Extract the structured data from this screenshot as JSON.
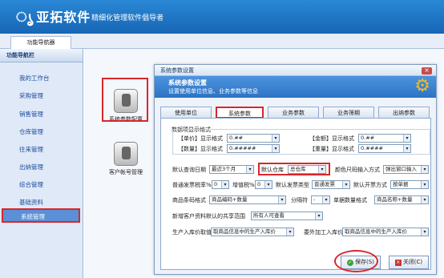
{
  "header": {
    "logo": "亚拓软件",
    "separator": "-",
    "slogan": "精细化管理软件倡导者"
  },
  "tabbar": {
    "tab": "功能导航器"
  },
  "sidebar": {
    "title": "功能导航栏",
    "items": [
      "我的工作台",
      "采购管理",
      "销售管理",
      "仓库管理",
      "往来管理",
      "出纳管理",
      "综合管理",
      "基础资料",
      "系统管理"
    ],
    "active": "系统管理"
  },
  "main": {
    "icons": [
      "系统参数配置",
      "客户帐号管理"
    ]
  },
  "dialog": {
    "title": "系统参数设置",
    "close": "×",
    "banner_title": "系统参数设置",
    "banner_sub": "设置使用单位信息、业务参数等信息",
    "tabs": [
      "使用单位",
      "系统参数",
      "业务参数",
      "业务筛期",
      "出纳参数"
    ],
    "active_tab": "系统参数",
    "group_label": "数据项显示格式",
    "format": {
      "price_label": "【单价】显示格式",
      "price": "0.##",
      "amount_label": "【金额】显示格式",
      "amount": "0.##",
      "qty_label": "【数量】显示格式",
      "qty": "0.#####",
      "weight_label": "【重量】显示格式",
      "weight": "0.####"
    },
    "row1": {
      "query_label": "默认查询日期",
      "query": "最近3个月",
      "wh_label": "默认仓库",
      "wh": "总仓库",
      "color_label": "颜色尺码输入方式",
      "color": "弹出窗口输入"
    },
    "row2": {
      "tax_label": "普通发票税率%",
      "tax": "0",
      "vat_label": "增值税%",
      "vat": "0",
      "invoice_label": "默认发票类型",
      "invoice": "普通发票",
      "open_label": "默认开票方式",
      "open": "按单据"
    },
    "row3": {
      "barcode_label": "商品条码格式",
      "barcode": "商品编码+数量",
      "sep_label": "分隔符",
      "sep": "-",
      "unit_label": "单据数量格式",
      "unit": "商品名称+数量"
    },
    "row4": {
      "share_label": "新增客户资料默认的共享范围",
      "share": "所有人可查看"
    },
    "row5": {
      "inprice_label": "生产入库价取值",
      "inprice": "取商品信息中的生产入库价",
      "outsource_label": "委外加工入库价",
      "outsource": "取商品信息中的生产入库价"
    },
    "save": "保存(S)",
    "cancel": "关闭(C)"
  },
  "colors": {
    "accent": "#1766b4",
    "highlight": "#d9262b"
  }
}
